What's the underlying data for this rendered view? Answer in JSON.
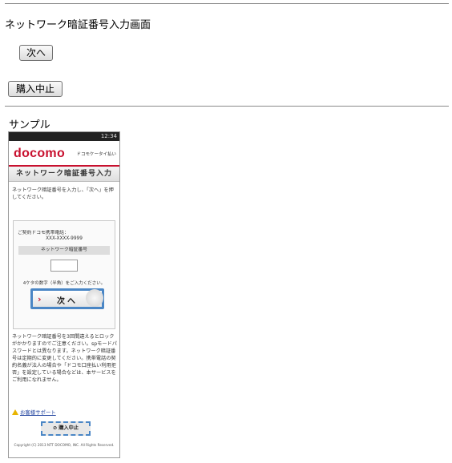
{
  "page": {
    "title": "ネットワーク暗証番号入力画面",
    "next_button": "次へ",
    "cancel_button": "購入中止",
    "sample_label": "サンプル"
  },
  "sample_phone": {
    "status_time": "12:34",
    "logo": "docomo",
    "brand_sub": "ドコモケータイ払い",
    "screen_title": "ネットワーク暗証番号入力",
    "instruction": "ネットワーク暗証番号を入力し、「次へ」を押してください。",
    "contract_label": "ご契約ドコモ携帯電話：",
    "phone_number": "XXX-XXXX-9999",
    "field_label": "ネットワーク暗証番号",
    "input_hint": "4ケタの数字（半角）をご入力ください。",
    "next_button": "次へ",
    "notes": "ネットワーク暗証番号を3回間違えるとロックがかかりますのでご注意ください。spモードパスワードとは異なります。ネットワーク暗証番号は定期的に変更してください。携帯電話の契約名義が法人の場合や「ドコモ口座払い利用拒否」を設定している場合などは、本サービスをご利用になれません。",
    "support_link": "お客様サポート",
    "cancel_button": "購入中止",
    "footer": "Copyright (C) 2013 NTT DOCOMO, INC. All Rights Reserved."
  },
  "colors": {
    "docomo_red": "#c8102e",
    "focus_blue": "#4a86c5",
    "link_blue": "#1a3d9c"
  }
}
